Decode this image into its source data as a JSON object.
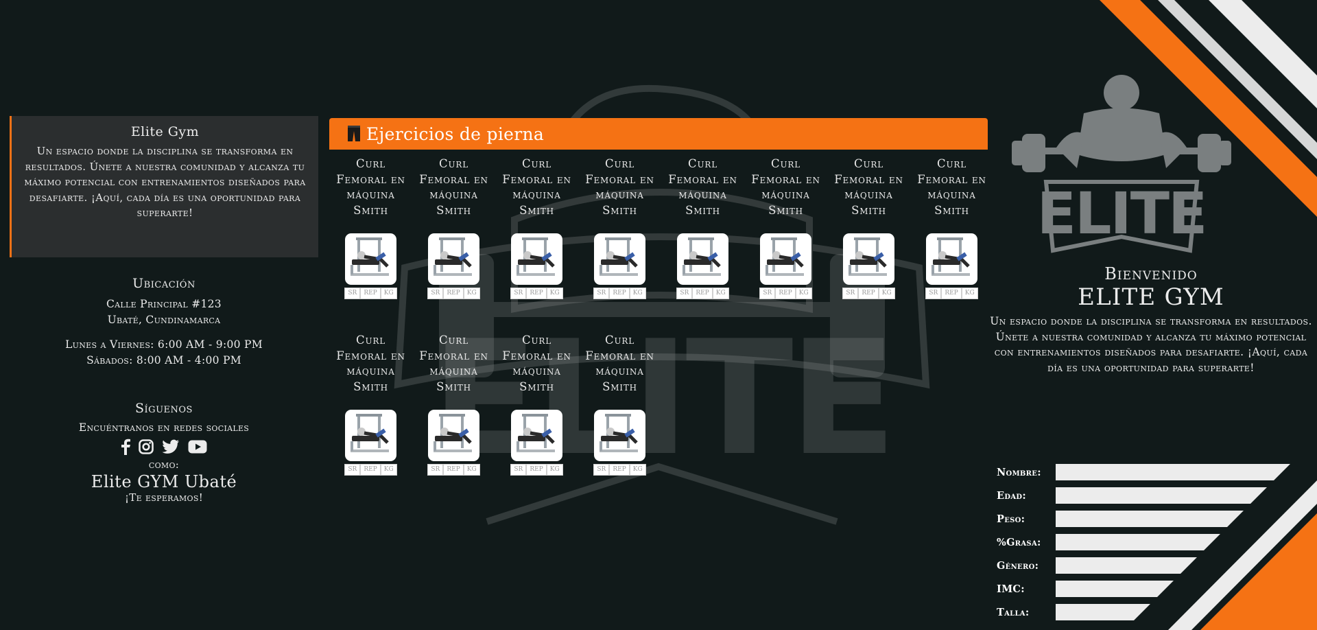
{
  "colors": {
    "background": "#111a1a",
    "accent": "#f57214",
    "panel": "#2b2e2f",
    "stripe_light": "#ececec"
  },
  "about": {
    "title": "Elite Gym",
    "text": "Un espacio donde la disciplina se transforma en resultados. Únete a nuestra comunidad y alcanza tu máximo potencial con entrenamientos diseñados para desafiarte. ¡Aquí, cada día es una oportunidad para superarte!"
  },
  "location": {
    "title": "Ubicación",
    "street": "Calle Principal #123",
    "city": "Ubaté, Cundinamarca",
    "weekdays": "Lunes a Viernes: 6:00 AM - 9:00 PM",
    "saturday": "Sábados: 8:00 AM - 4:00 PM"
  },
  "social": {
    "title": "Síguenos",
    "tagline": "Encuéntranos en redes sociales",
    "icons": [
      "facebook-icon",
      "instagram-icon",
      "twitter-icon",
      "youtube-icon"
    ],
    "como": "como:",
    "brand": "Elite GYM Ubaté",
    "bye": "¡Te esperamos!"
  },
  "panel": {
    "icon": "leg-pants-icon",
    "title": "Ejercicios de pierna"
  },
  "exercises": [
    {
      "name": "Curl Femoral en máquina Smith"
    },
    {
      "name": "Curl Femoral en máquina Smith"
    },
    {
      "name": "Curl Femoral en máquina Smith"
    },
    {
      "name": "Curl Femoral en máquina Smith"
    },
    {
      "name": "Curl Femoral en máquina Smith"
    },
    {
      "name": "Curl Femoral en máquina Smith"
    },
    {
      "name": "Curl Femoral en máquina Smith"
    },
    {
      "name": "Curl Femoral en máquina Smith"
    },
    {
      "name": "Curl Femoral en máquina Smith"
    },
    {
      "name": "Curl Femoral en máquina Smith"
    },
    {
      "name": "Curl Femoral en máquina Smith"
    },
    {
      "name": "Curl Femoral en máquina Smith"
    }
  ],
  "exercise_fields": {
    "sr": "SR",
    "rep": "REP",
    "kg": "KG"
  },
  "welcome": {
    "greeting": "Bienvenido",
    "brand": "ELITE GYM",
    "text": "Un espacio donde la disciplina se transforma en resultados. Únete a nuestra comunidad y alcanza tu máximo potencial con entrenamientos diseñados para desafiarte. ¡Aquí, cada día es una oportunidad para superarte!"
  },
  "logo": {
    "text": "ELITE"
  },
  "profile_form": [
    {
      "label": "Nombre:",
      "value": ""
    },
    {
      "label": "Edad:",
      "value": ""
    },
    {
      "label": "Peso:",
      "value": ""
    },
    {
      "label": "%Grasa:",
      "value": ""
    },
    {
      "label": "Género:",
      "value": ""
    },
    {
      "label": "IMC:",
      "value": ""
    },
    {
      "label": "Talla:",
      "value": ""
    }
  ]
}
